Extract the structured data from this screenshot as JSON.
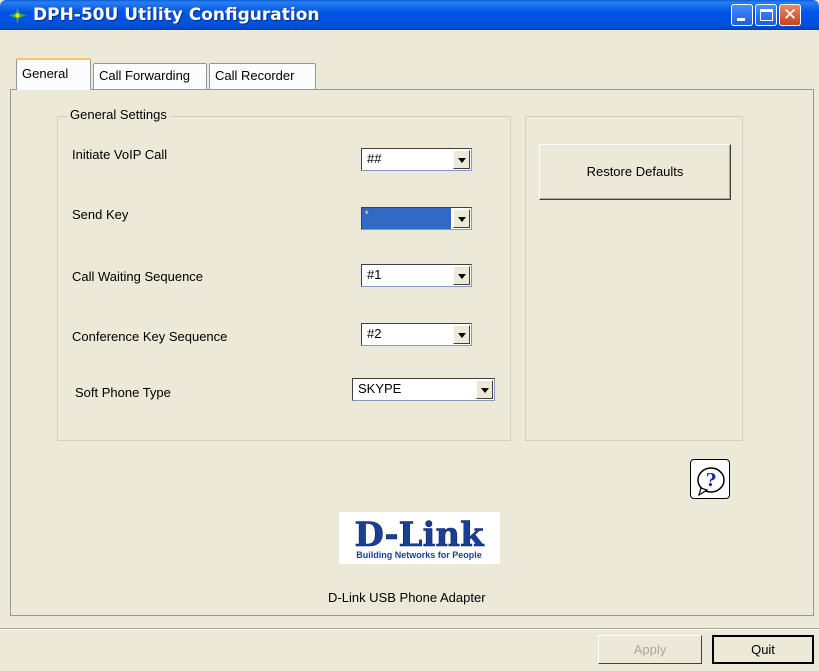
{
  "window": {
    "title": "DPH-50U Utility Configuration",
    "icon": "dlink-app-icon",
    "controls": [
      "minimize-icon",
      "maximize-icon",
      "close-icon"
    ]
  },
  "tabs": [
    {
      "label": "General",
      "active": true
    },
    {
      "label": "Call Forwarding",
      "active": false
    },
    {
      "label": "Call Recorder",
      "active": false
    }
  ],
  "general_settings": {
    "legend": "General Settings",
    "fields": [
      {
        "label": "Initiate VoIP Call",
        "value": "##"
      },
      {
        "label": "Send Key",
        "value": "*",
        "selected": true
      },
      {
        "label": "Call Waiting Sequence",
        "value": "#1"
      },
      {
        "label": "Conference Key Sequence",
        "value": "#2"
      },
      {
        "label": "Soft Phone Type",
        "value": "SKYPE"
      }
    ]
  },
  "restore_defaults_label": "Restore Defaults",
  "help_icon": "question-mark-icon",
  "logo": {
    "brand": "D-Link",
    "tagline": "Building Networks for People"
  },
  "caption": "D-Link USB Phone Adapter",
  "buttons": {
    "apply": "Apply",
    "quit": "Quit"
  },
  "colors": {
    "titlebar": "#0055e5",
    "selection": "#316ac5",
    "logo_blue": "#1c3f94"
  }
}
